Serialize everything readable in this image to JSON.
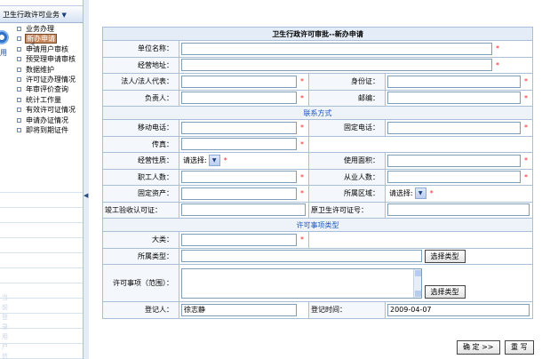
{
  "sidebar": {
    "title": "卫生行政许可业务",
    "dropdown_glyph": "▼",
    "vertical_label": "用",
    "items": [
      {
        "label": "业务办理"
      },
      {
        "label": "新办申请",
        "selected": true
      },
      {
        "label": "申请用户审核"
      },
      {
        "label": "预受理申请审核"
      },
      {
        "label": "数据维护"
      },
      {
        "label": "许可证办理情况"
      },
      {
        "label": "年审评价查询"
      },
      {
        "label": "统计工作量"
      },
      {
        "label": "有效许可证情况"
      },
      {
        "label": "申请办证情况"
      },
      {
        "label": "即将到期证件"
      }
    ],
    "faint_text": "当前登录用户信息"
  },
  "form": {
    "title": "卫生行政许可审批--新办申请",
    "required_mark": "*",
    "labels": {
      "unit_name": "单位名称：",
      "address": "经营地址：",
      "legal_rep": "法人/法人代表：",
      "id_card": "身份证：",
      "person_in_charge": "负责人：",
      "postcode": "邮编：",
      "contact_section": "联系方式",
      "mobile": "移动电话：",
      "landline": "固定电话：",
      "fax": "传真：",
      "nature": "经营性质：",
      "area_used": "使用面积：",
      "employees": "职工人数：",
      "practitioners": "从业人数：",
      "fixed_assets": "固定资产：",
      "region": "所属区域：",
      "acceptance_cert": "竣工验收认可证：",
      "old_license": "原卫生许可证号：",
      "license_section": "许可事项类型",
      "category": "大类：",
      "type": "所属类型：",
      "scope": "许可事项（范围）：",
      "registrar": "登记人：",
      "reg_time": "登记时间："
    },
    "selects": {
      "nature": "请选择:",
      "region": "请选择:"
    },
    "values": {
      "registrar": "徐志静",
      "reg_time": "2009-04-07"
    },
    "buttons": {
      "select_type_1": "选择类型",
      "select_type_2": "选择类型",
      "confirm": "确 定 >>",
      "rewrite": "重 写"
    }
  }
}
